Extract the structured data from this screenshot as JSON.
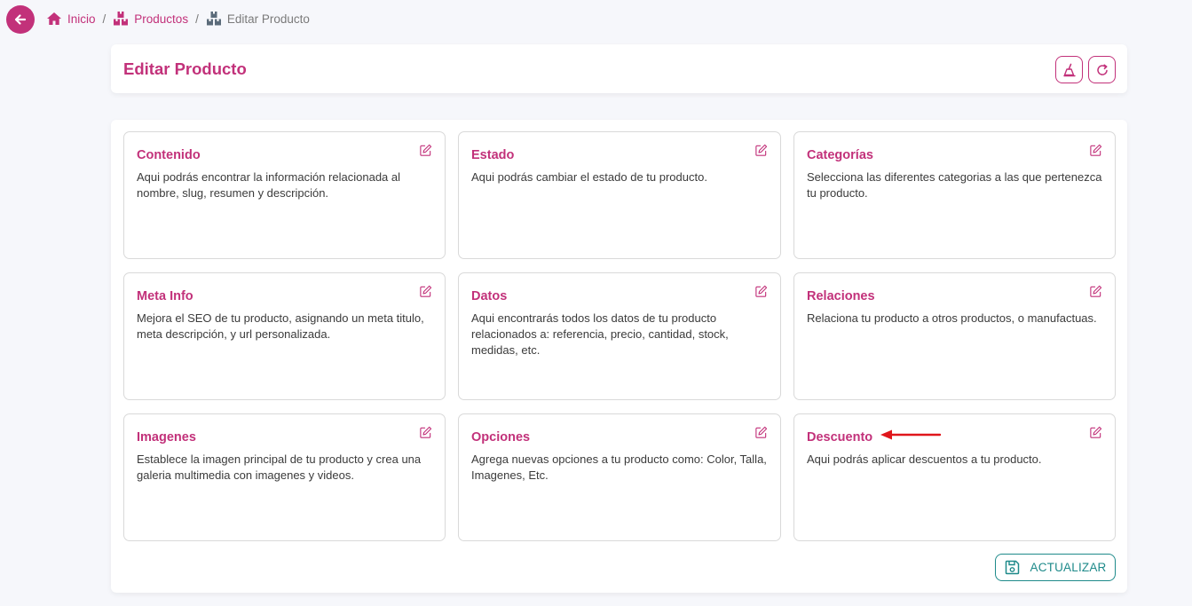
{
  "breadcrumb": {
    "home": "Inicio",
    "products": "Productos",
    "current": "Editar Producto",
    "separator": "/"
  },
  "header": {
    "title": "Editar Producto"
  },
  "sections": [
    {
      "title": "Contenido",
      "description": "Aqui podrás encontrar la información relacionada al nombre, slug, resumen y descripción."
    },
    {
      "title": "Estado",
      "description": "Aqui podrás cambiar el estado de tu producto."
    },
    {
      "title": "Categorías",
      "description": "Selecciona las diferentes categorias a las que pertenezca tu producto."
    },
    {
      "title": "Meta Info",
      "description": "Mejora el SEO de tu producto, asignando un meta titulo, meta descripción, y url personalizada."
    },
    {
      "title": "Datos",
      "description": "Aqui encontrarás todos los datos de tu producto relacionados a: referencia, precio, cantidad, stock, medidas, etc."
    },
    {
      "title": "Relaciones",
      "description": "Relaciona tu producto a otros productos, o manufactuas."
    },
    {
      "title": "Imagenes",
      "description": "Establece la imagen principal de tu producto y crea una galeria multimedia con imagenes y videos."
    },
    {
      "title": "Opciones",
      "description": "Agrega nuevas opciones a tu producto como: Color, Talla, Imagenes, Etc."
    },
    {
      "title": "Descuento",
      "description": "Aqui podrás aplicar descuentos a tu producto."
    }
  ],
  "actions": {
    "save_label": "ACTUALIZAR"
  },
  "colors": {
    "brand": "#c2317a",
    "save": "#1e8a8a",
    "annotation_arrow": "#e0161b"
  },
  "icons": {
    "back": "arrow-left-icon",
    "home": "home-icon",
    "products": "boxes-icon",
    "edit": "edit-icon",
    "clean": "broom-icon",
    "refresh": "refresh-icon",
    "save": "floppy-disk-icon"
  }
}
